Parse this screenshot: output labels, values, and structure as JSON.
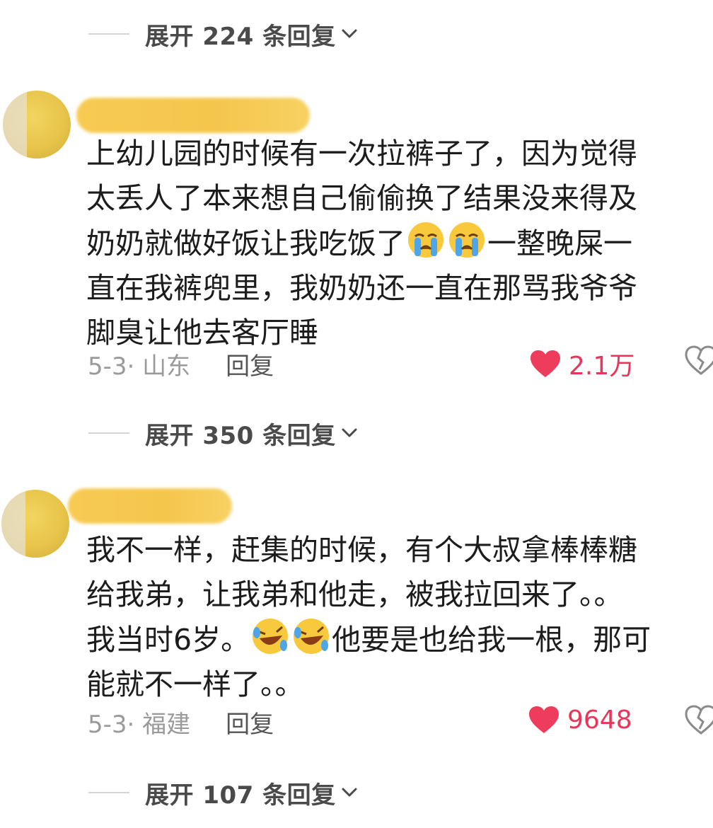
{
  "expanders": [
    {
      "label": "展开 224 条回复"
    },
    {
      "label": "展开 350 条回复"
    },
    {
      "label": "展开 107 条回复"
    }
  ],
  "comments": [
    {
      "lines": [
        "上幼儿园的时候有一次拉裤子了，因为觉得",
        "太丢人了本来想自己偷偷换了结果没来得及",
        "奶奶就做好饭让我吃饭了",
        "一整晚屎一",
        "直在我裤兜里，我奶奶还一直在那骂我爷爷",
        "脚臭让他去客厅睡"
      ],
      "date_region": "5-3· 山东",
      "reply": "回复",
      "likes": "2.1万"
    },
    {
      "lines": [
        "我不一样，赶集的时候，有个大叔拿棒棒糖",
        "给我弟，让我弟和他走，被我拉回来了。。",
        "我当时6岁。",
        "他要是也给我一根，那可",
        "能就不一样了。。"
      ],
      "date_region": "5-3· 福建",
      "reply": "回复",
      "likes": "9648"
    }
  ],
  "icons": {
    "expand": "chevron-down-icon",
    "like": "heart-icon",
    "dislike": "broken-heart-icon",
    "emoji1": "loudly-crying-face-icon",
    "emoji2": "rolling-on-floor-laughing-icon"
  },
  "colors": {
    "like": "#e8355a",
    "heart": "#ee3d5c",
    "name_blur": "#f5c443"
  }
}
